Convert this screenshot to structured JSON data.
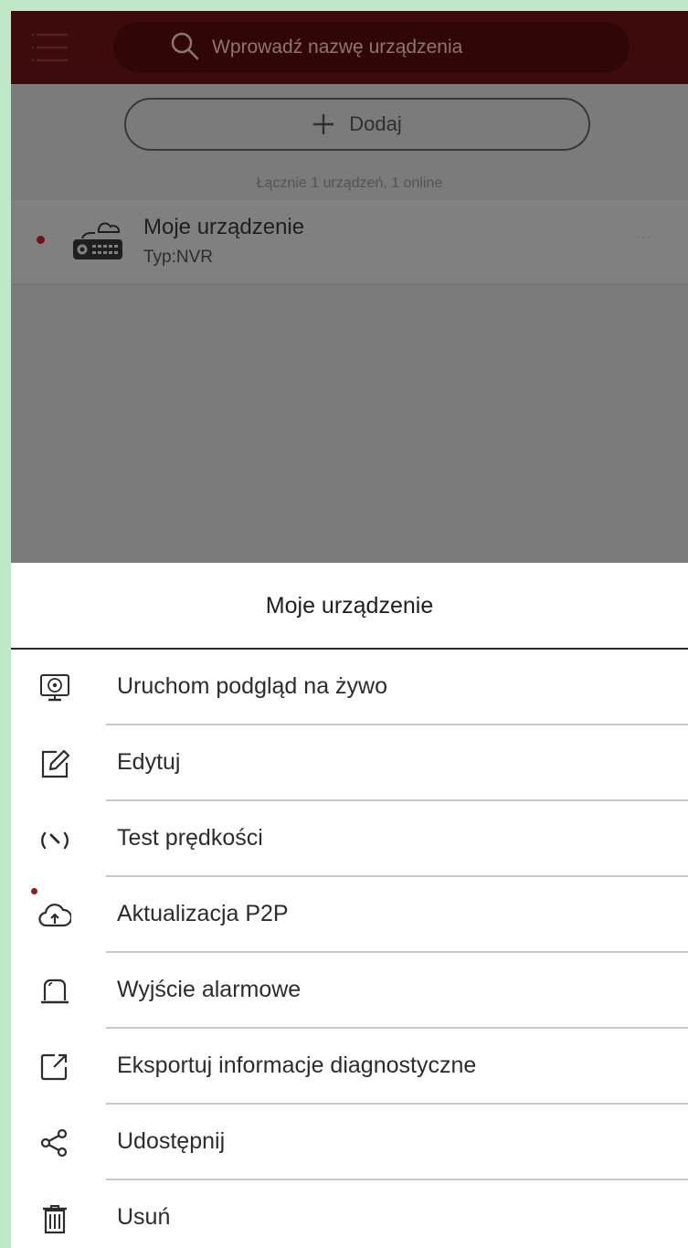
{
  "search": {
    "placeholder": "Wprowadź nazwę urządzenia"
  },
  "add_button": {
    "label": "Dodaj"
  },
  "summary": "Łącznie 1 urządzeń, 1 online",
  "device": {
    "name": "Moje urządzenie",
    "type": "Typ:NVR",
    "more": "···"
  },
  "sheet": {
    "title": "Moje urządzenie",
    "items": [
      {
        "label": "Uruchom podgląd na żywo",
        "icon": "live-view-monitor-icon"
      },
      {
        "label": "Edytuj",
        "icon": "edit-icon"
      },
      {
        "label": "Test prędkości",
        "icon": "speedometer-icon"
      },
      {
        "label": "Aktualizacja P2P",
        "icon": "cloud-upload-icon"
      },
      {
        "label": "Wyjście alarmowe",
        "icon": "alarm-bell-icon"
      },
      {
        "label": "Eksportuj informacje diagnostyczne",
        "icon": "export-icon"
      },
      {
        "label": "Udostępnij",
        "icon": "share-icon"
      },
      {
        "label": "Usuń",
        "icon": "trash-icon"
      }
    ]
  },
  "colors": {
    "topbar": "#3d0b0b",
    "overlay": "#7b7b7b",
    "accent": "#6b1414"
  }
}
